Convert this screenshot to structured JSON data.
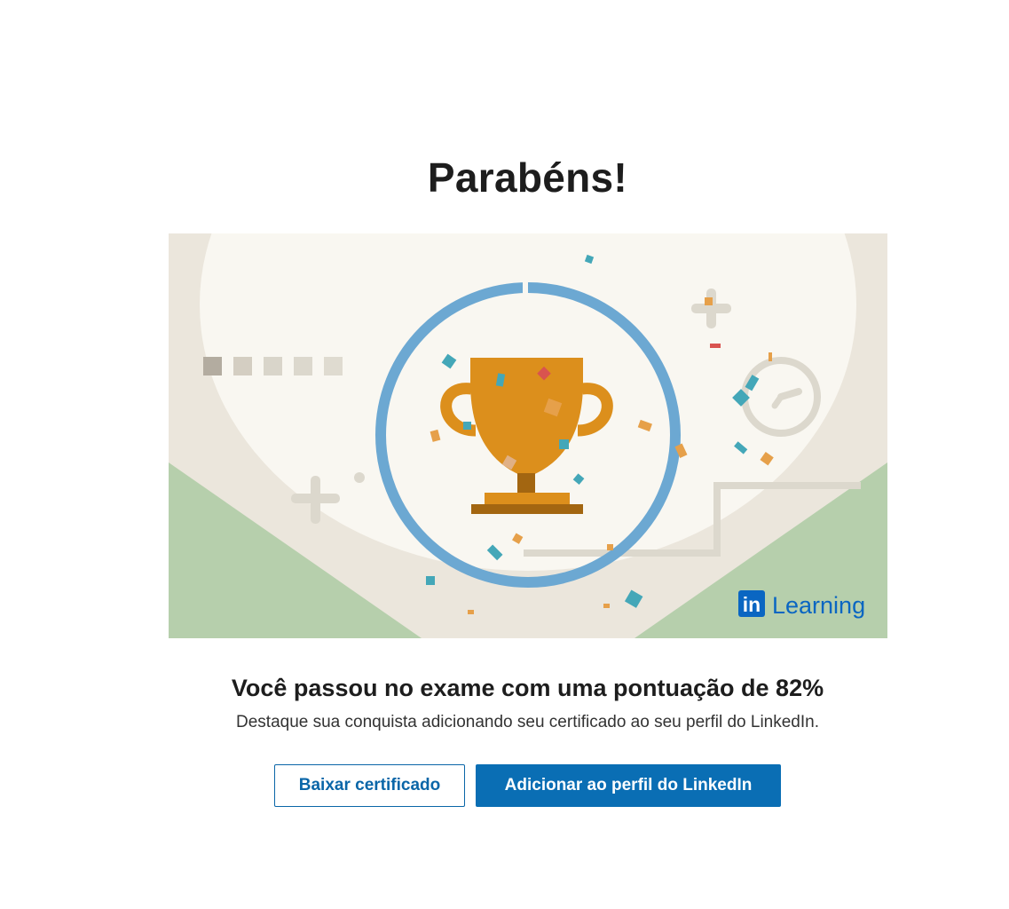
{
  "header": {
    "title": "Parabéns!"
  },
  "illustration": {
    "icon": "trophy-icon",
    "brand": {
      "logo_text": "in",
      "product_text": "Learning"
    },
    "colors": {
      "background": "#ebe6dc",
      "cream": "#f9f7f1",
      "green": "#b6cfac",
      "ring": "#6ca8d2",
      "trophy": "#dc8f1c",
      "trophy_dark": "#a36611",
      "shapes": "#d7d4c8",
      "brand_blue": "#0a66c2"
    }
  },
  "result": {
    "heading": "Você passou no exame com uma pontuação de 82%",
    "subtext": "Destaque sua conquista adicionando seu certificado ao seu perfil do LinkedIn."
  },
  "actions": {
    "download_label": "Baixar certificado",
    "add_profile_label": "Adicionar ao perfil do LinkedIn"
  },
  "theme": {
    "primary": "#0a6eb4",
    "text": "#1d1d1d"
  }
}
